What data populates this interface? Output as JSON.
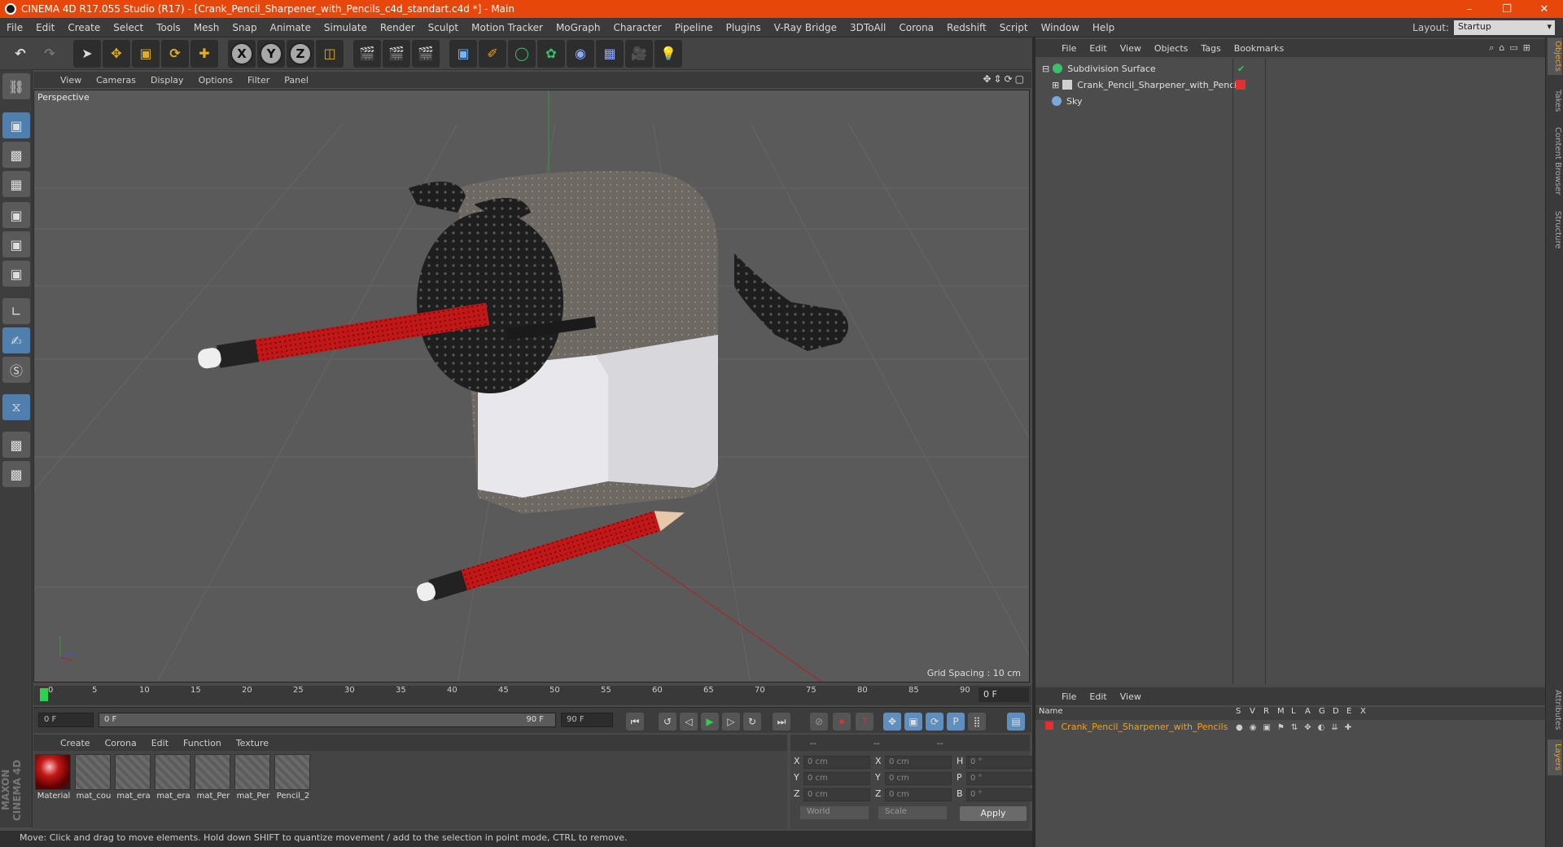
{
  "window": {
    "title": "CINEMA 4D R17.055 Studio (R17) - [Crank_Pencil_Sharpener_with_Pencils_c4d_standart.c4d *] - Main"
  },
  "menubar": {
    "items": [
      "File",
      "Edit",
      "Create",
      "Select",
      "Tools",
      "Mesh",
      "Snap",
      "Animate",
      "Simulate",
      "Render",
      "Sculpt",
      "Motion Tracker",
      "MoGraph",
      "Character",
      "Pipeline",
      "Plugins",
      "V-Ray Bridge",
      "3DToAll",
      "Corona",
      "Redshift",
      "Script",
      "Window",
      "Help"
    ],
    "layout_label": "Layout:",
    "layout_value": "Startup"
  },
  "toolbar": {
    "axis_x": "X",
    "axis_y": "Y",
    "axis_z": "Z"
  },
  "viewport": {
    "menu": [
      "View",
      "Cameras",
      "Display",
      "Options",
      "Filter",
      "Panel"
    ],
    "label": "Perspective",
    "grid_spacing": "Grid Spacing : 10 cm"
  },
  "timeline": {
    "ticks": [
      "0",
      "5",
      "10",
      "15",
      "20",
      "25",
      "30",
      "35",
      "40",
      "45",
      "50",
      "55",
      "60",
      "65",
      "70",
      "75",
      "80",
      "85",
      "90"
    ],
    "current_frame": "0 F"
  },
  "playbar": {
    "start": "0 F",
    "range_start": "0 F",
    "range_end": "90 F",
    "end": "90 F"
  },
  "materials": {
    "menu": [
      "Create",
      "Corona",
      "Edit",
      "Function",
      "Texture"
    ],
    "items": [
      "Material",
      "mat_cou",
      "mat_era",
      "mat_era",
      "mat_Per",
      "mat_Per",
      "Pencil_2"
    ]
  },
  "coords": {
    "head": [
      "--",
      "--",
      "--"
    ],
    "rows": [
      {
        "a": "X",
        "av": "0 cm",
        "b": "X",
        "bv": "0 cm",
        "c": "H",
        "cv": "0 °"
      },
      {
        "a": "Y",
        "av": "0 cm",
        "b": "Y",
        "bv": "0 cm",
        "c": "P",
        "cv": "0 °"
      },
      {
        "a": "Z",
        "av": "0 cm",
        "b": "Z",
        "bv": "0 cm",
        "c": "B",
        "cv": "0 °"
      }
    ],
    "world": "World",
    "scale": "Scale",
    "apply": "Apply"
  },
  "status": {
    "text": "Move: Click and drag to move elements. Hold down SHIFT to quantize movement / add to the selection in point mode, CTRL to remove."
  },
  "objects": {
    "menu": [
      "File",
      "Edit",
      "View",
      "Objects",
      "Tags",
      "Bookmarks"
    ],
    "items": [
      {
        "name": "Subdivision Surface",
        "color": "#3cbf6a"
      },
      {
        "name": "Crank_Pencil_Sharpener_with_Pencils",
        "color": "#8888ff"
      },
      {
        "name": "Sky",
        "color": "#7aa8d8"
      }
    ]
  },
  "layers": {
    "menu": [
      "File",
      "Edit",
      "View"
    ],
    "columns": [
      "Name",
      "S",
      "V",
      "R",
      "M",
      "L",
      "A",
      "G",
      "D",
      "E",
      "X"
    ],
    "row": "Crank_Pencil_Sharpener_with_Pencils",
    "row_color": "#f0a020"
  },
  "side_tabs": [
    "Objects",
    "Takes",
    "Content Browser",
    "Structure",
    "Attributes",
    "Layers"
  ],
  "brand": "MAXON CINEMA 4D"
}
